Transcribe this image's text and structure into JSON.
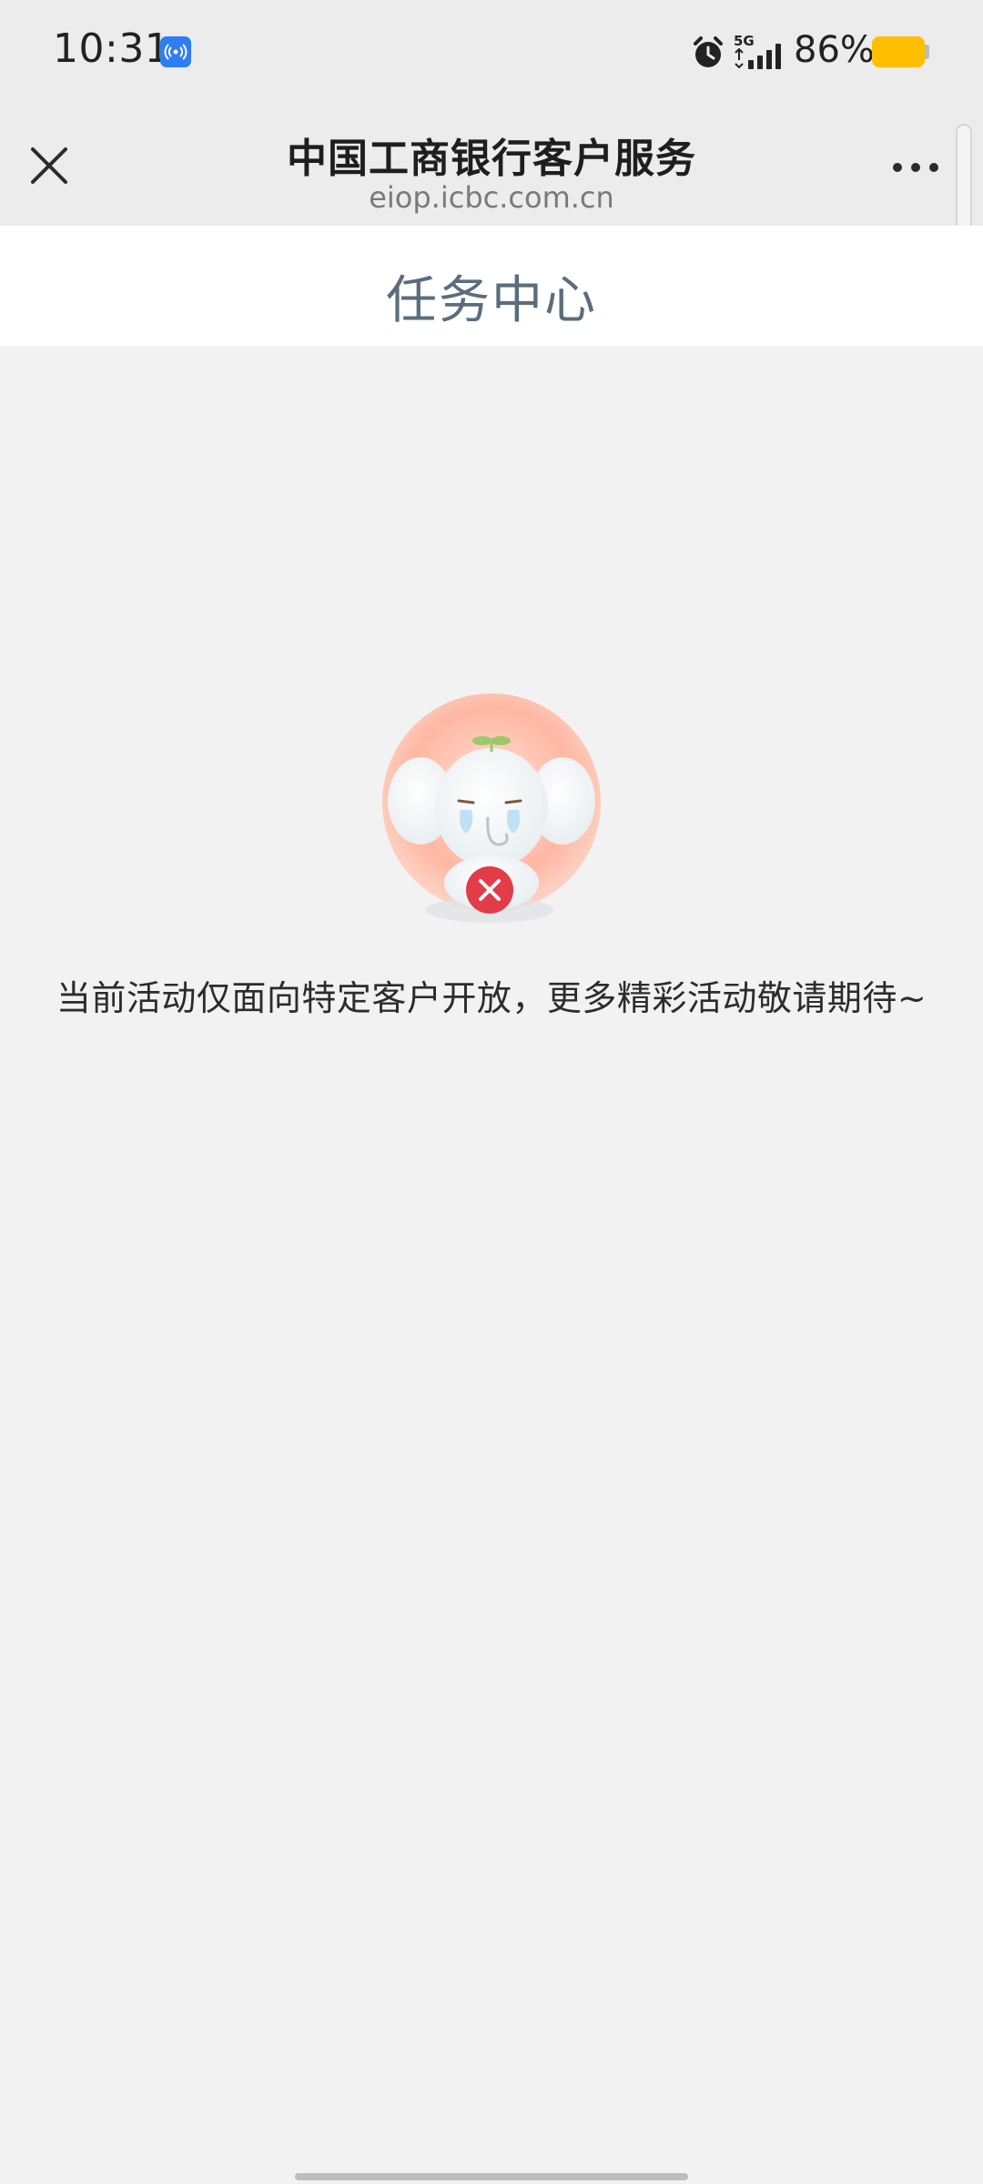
{
  "status_bar": {
    "time": "10:31",
    "network": "5G",
    "battery": "86%",
    "battery_color": "#ffbf00"
  },
  "nav": {
    "title": "中国工商银行客户服务",
    "url": "eiop.icbc.com.cn"
  },
  "page": {
    "title": "任务中心"
  },
  "empty_state": {
    "message": "当前活动仅面向特定客户开放，更多精彩活动敬请期待~",
    "illustration": "crying-elephant-mascot"
  },
  "colors": {
    "page_title": "#5b6d7c",
    "accent_red": "#e23c48"
  }
}
